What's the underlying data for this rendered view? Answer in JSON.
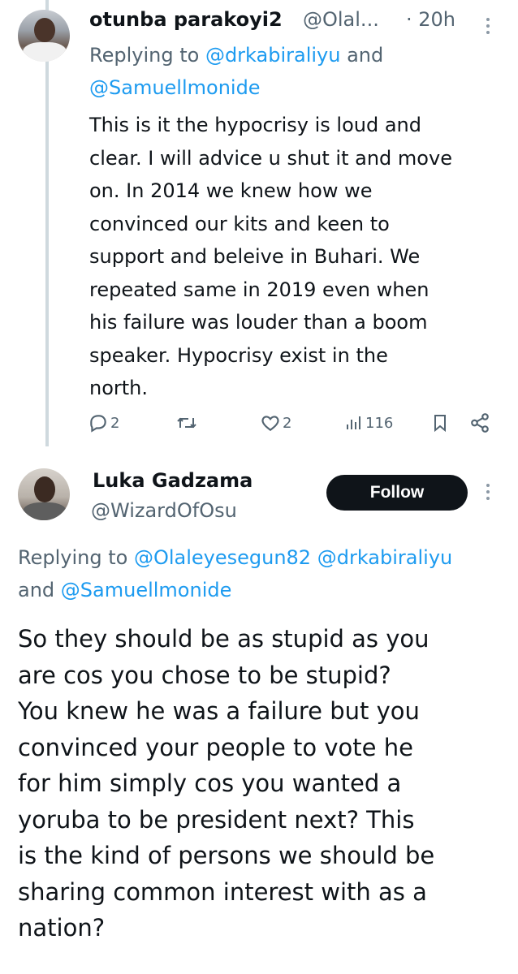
{
  "tweet1": {
    "name": "otunba parakoyi2",
    "handle": "@Olal...",
    "time": "· 20h",
    "reply_prefix": "Replying to ",
    "reply_mention_1": "@drkabiraliyu",
    "reply_and": " and",
    "reply_mention_2": "@Samuellmonide",
    "text": "This is it the hypocrisy is loud and\nclear. I will advice u shut it and move\non. In 2014 we knew how we\nconvinced our kits and keen to\nsupport and beleive in Buhari. We\nrepeated same in 2019 even when\nhis failure was louder than a boom\nspeaker. Hypocrisy exist in the\nnorth.",
    "actions": {
      "reply_count": "2",
      "retweet_count": "",
      "like_count": "2",
      "views_count": "116"
    }
  },
  "tweet2": {
    "name": "Luka Gadzama",
    "handle": "@WizardOfOsu",
    "follow_label": "Follow",
    "reply_prefix": "Replying to ",
    "reply_mention_1": "@Olaleyesegun82",
    "reply_mention_2": "@drkabiraliyu",
    "reply_and": "and ",
    "reply_mention_3": "@Samuellmonide",
    "text": "So they should be as stupid as you\nare cos you chose to be stupid?\nYou knew he was a failure but you\nconvinced your people to vote he\nfor him simply cos you wanted a\nyoruba to be president next? This\nis the kind of persons we should be\nsharing common interest with as a\nnation?"
  },
  "colors": {
    "text": "#0f1419",
    "secondary": "#536471",
    "link": "#1d9bf0",
    "thread_line": "#cfd9de",
    "follow_bg": "#0f1419"
  },
  "icons": [
    "reply-icon",
    "retweet-icon",
    "like-icon",
    "views-icon",
    "bookmark-icon",
    "share-icon",
    "more-icon"
  ]
}
